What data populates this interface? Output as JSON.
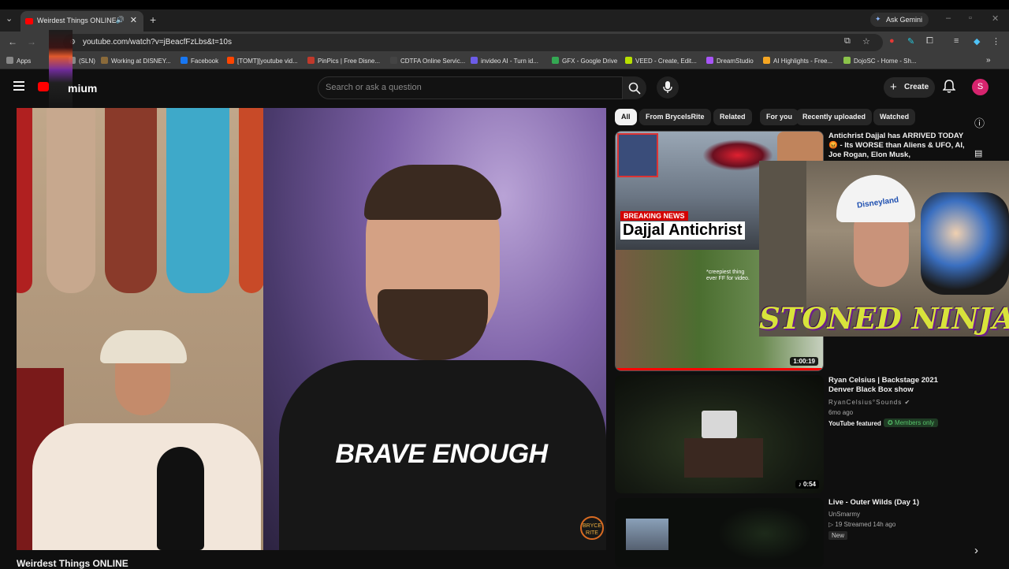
{
  "browser": {
    "tab_title": "Weirdest Things ONLINE - Y",
    "url": "youtube.com/watch?v=jBeacfFzLbs&t=10s",
    "gemini_label": "Ask Gemini",
    "bookmarks": [
      {
        "label": "Apps",
        "color": "#888888"
      },
      {
        "label": "(SLN)",
        "color": "#888888"
      },
      {
        "label": "Working at DISNEY...",
        "color": "#8a6a3a"
      },
      {
        "label": "Facebook",
        "color": "#1877f2"
      },
      {
        "label": "[TOMT][youtube vid...",
        "color": "#ff4500"
      },
      {
        "label": "PinPics | Free Disne...",
        "color": "#c0392b"
      },
      {
        "label": "CDTFA Online Servic...",
        "color": "#444444"
      },
      {
        "label": "invideo AI - Turn id...",
        "color": "#6c5ce7"
      },
      {
        "label": "GFX - Google Drive",
        "color": "#34a853"
      },
      {
        "label": "VEED - Create, Edit...",
        "color": "#b8e000"
      },
      {
        "label": "DreamStudio",
        "color": "#a855f7"
      },
      {
        "label": "AI Highlights - Free...",
        "color": "#f5a623"
      },
      {
        "label": "DojoSC - Home - Sh...",
        "color": "#8bc34a"
      }
    ]
  },
  "youtube": {
    "logo_text": "mium",
    "search_placeholder": "Search or ask a question",
    "create_label": "Create",
    "avatar_letter": "S",
    "video": {
      "caption": "BRAVE ENOUGH",
      "title": "Weirdest Things ONLINE",
      "channel_bug": "BRYCE RITE"
    },
    "chips": [
      "All",
      "From BryceIsRite",
      "Related",
      "For you",
      "Recently uploaded",
      "Watched"
    ],
    "recommendations": [
      {
        "title": "Antichrist Dajjal has ARRIVED TODAY 😡 - Its WORSE than Aliens & UFO, AI, Joe Rogan, Elon Musk,",
        "thumb_top_text": "BREAKING NEWS",
        "thumb_main_text": "Dajjal Antichrist",
        "thumb_small_text": "*creepiest thing ever FF for video.",
        "duration": "1:00:19"
      },
      {
        "title": "Ryan Celsius | Backstage 2021 Denver Black Box show",
        "channel": "RyanCelsius°Sounds",
        "age": "6mo ago",
        "badge_featured": "YouTube featured",
        "badge_members": "Members only",
        "duration": "0:54"
      },
      {
        "title": "Live - Outer Wilds (Day 1)",
        "channel": "UnSmarmy",
        "meta": "19  Streamed 14h ago",
        "badge_new": "New"
      }
    ],
    "overlay_text": "STONED NINJA",
    "overlay_hat_text": "Disneyland"
  }
}
